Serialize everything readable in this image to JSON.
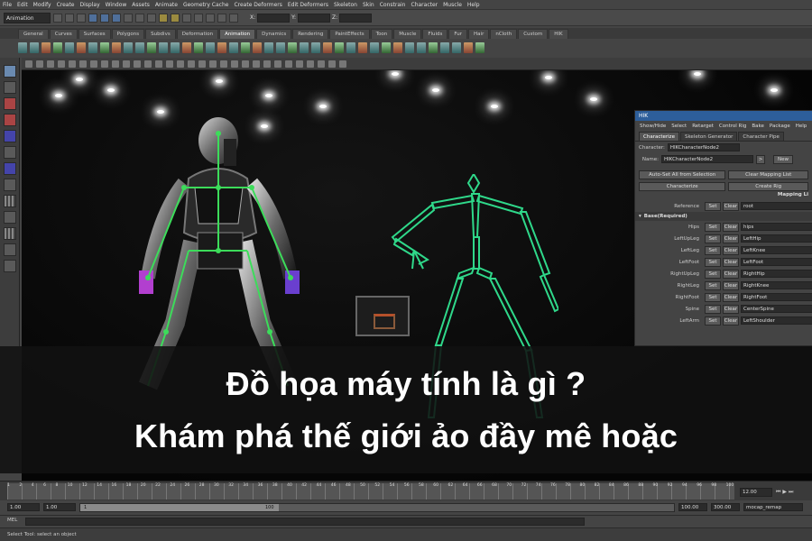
{
  "menubar": {
    "items": [
      "File",
      "Edit",
      "Modify",
      "Create",
      "Display",
      "Window",
      "Assets",
      "Animate",
      "Geometry Cache",
      "Create Deformers",
      "Edit Deformers",
      "Skeleton",
      "Skin",
      "Constrain",
      "Character",
      "Muscle",
      "Help"
    ]
  },
  "statusline": {
    "mode": "Animation",
    "x_label": "X:",
    "y_label": "Y:",
    "z_label": "Z:"
  },
  "shelf": {
    "tabs": [
      "General",
      "Curves",
      "Surfaces",
      "Polygons",
      "Subdivs",
      "Deformation",
      "Animation",
      "Dynamics",
      "Rendering",
      "PaintEffects",
      "Toon",
      "Muscle",
      "Fluids",
      "Fur",
      "Hair",
      "nCloth",
      "Custom",
      "HIK"
    ],
    "active_tab": "Animation"
  },
  "hik": {
    "title": "HIK",
    "menu": [
      "Show/Hide",
      "Select",
      "Retarget",
      "Control Rig",
      "Bake",
      "Package",
      "Help"
    ],
    "tabs": [
      "Characterize",
      "Skeleton Generator",
      "Character Pipe"
    ],
    "active_tab": "Characterize",
    "character_label": "Character:",
    "character_value": "HIKCharacterNode2",
    "name_label": "Name:",
    "name_value": "HIKCharacterNode2",
    "name_arrow": ">",
    "new_button": "New",
    "auto_set_button": "Auto-Set All from Selection",
    "clear_mapping_button": "Clear Mapping List",
    "characterize_button": "Characterize",
    "create_rig_button": "Create Rig",
    "mapping_header": "Mapping Li",
    "reference_label": "Reference",
    "reference_value": "root",
    "set_label": "Set",
    "clear_label": "Clear",
    "section_label": "Base(Required)",
    "mapping": [
      {
        "joint": "Hips",
        "value": "hips"
      },
      {
        "joint": "LeftUpLeg",
        "value": "LeftHip"
      },
      {
        "joint": "LeftLeg",
        "value": "LeftKnee"
      },
      {
        "joint": "LeftFoot",
        "value": "LeftFoot"
      },
      {
        "joint": "RightUpLeg",
        "value": "RightHip"
      },
      {
        "joint": "RightLeg",
        "value": "RightKnee"
      },
      {
        "joint": "RightFoot",
        "value": "RightFoot"
      },
      {
        "joint": "Spine",
        "value": "CenterSpine"
      },
      {
        "joint": "LeftArm",
        "value": "LeftShoulder"
      }
    ]
  },
  "caption": {
    "line1": "Đồ họa máy tính là gì ?",
    "line2": "Khám phá thế giới ảo đầy mê hoặc"
  },
  "timeline": {
    "ticks": [
      "1",
      "2",
      "4",
      "6",
      "8",
      "10",
      "12",
      "14",
      "16",
      "18",
      "20",
      "22",
      "24",
      "26",
      "28",
      "30",
      "32",
      "34",
      "36",
      "38",
      "40",
      "42",
      "44",
      "46",
      "48",
      "50",
      "52",
      "54",
      "56",
      "58",
      "60",
      "62",
      "64",
      "66",
      "68",
      "70",
      "72",
      "74",
      "76",
      "78",
      "80",
      "82",
      "84",
      "86",
      "88",
      "90",
      "92",
      "94",
      "96",
      "98",
      "100"
    ],
    "current_time": "12.00"
  },
  "range": {
    "start": "1.00",
    "current": "1.00",
    "slider_start": "1",
    "slider_end": "100",
    "end": "100.00",
    "max": "300.00",
    "layer": "mocap_remap"
  },
  "cmdline": {
    "label": "MEL"
  },
  "helpline": {
    "text": "Select Tool: select an object"
  }
}
